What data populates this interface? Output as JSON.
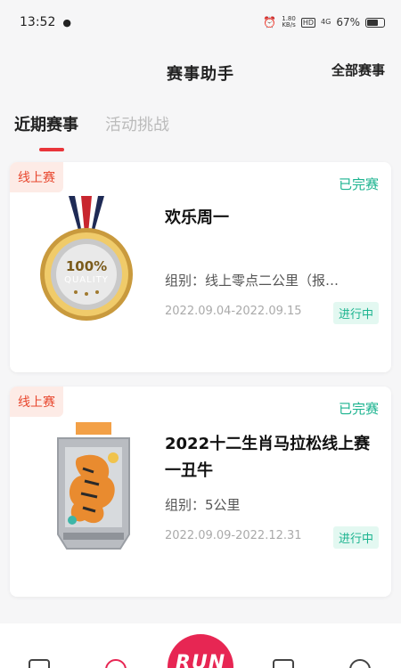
{
  "status_bar": {
    "time": "13:52",
    "net_speed_value": "1.80",
    "net_speed_unit": "KB/s",
    "hd": "HD",
    "signal": "4G",
    "battery": "67%"
  },
  "header": {
    "title": "赛事助手",
    "right_link": "全部赛事"
  },
  "tabs": [
    {
      "label": "近期赛事",
      "active": true
    },
    {
      "label": "活动挑战",
      "active": false
    }
  ],
  "cards": [
    {
      "tag": "线上赛",
      "status": "已完赛",
      "title": "欢乐周一",
      "group": "组别：线上零点二公里（报…",
      "date_range": "2022.09.04-2022.09.15",
      "state_badge": "进行中",
      "medal_text_top": "100%",
      "medal_text_bottom": "QUALITY"
    },
    {
      "tag": "线上赛",
      "status": "已完赛",
      "title": "2022十二生肖马拉松线上赛一丑牛",
      "group": "组别：5公里",
      "date_range": "2022.09.09-2022.12.31",
      "state_badge": "进行中"
    }
  ],
  "bottom_nav": {
    "run_label": "RUN"
  },
  "colors": {
    "accent_red": "#e9353a",
    "tag_bg": "#fdebe6",
    "tag_text": "#e8472e",
    "status_green": "#1bb38f",
    "run_pink": "#e72653"
  }
}
